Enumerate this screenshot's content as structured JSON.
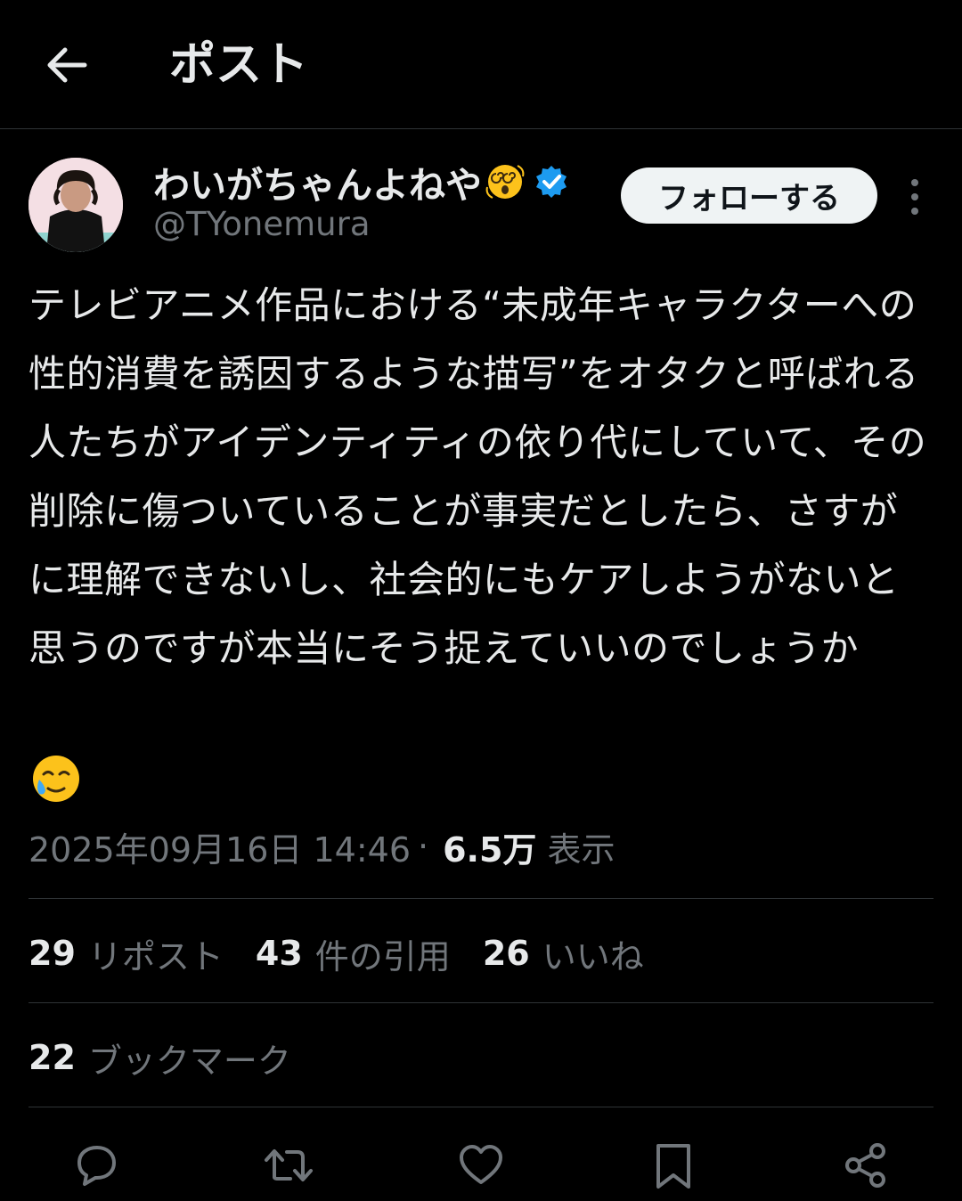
{
  "header": {
    "title": "ポスト",
    "back_icon": "arrow-left-icon"
  },
  "author": {
    "display_name": "わいがちゃんよねや",
    "name_emoji": "face-with-spiral-eyes",
    "verified": true,
    "handle": "@TYonemura",
    "follow_label": "フォローする"
  },
  "post": {
    "text": "テレビアニメ作品における“未成年キャラクターへの性的消費を誘因するような描写”をオタクと呼ばれる人たちがアイデンティティの依り代にしていて、その削除に傷ついていることが事実だとしたら、さすがに理解できないし、社会的にもケアしようがないと思うのですが本当にそう捉えていいのでしょうか",
    "trailing_emoji": "face-holding-back-tears",
    "timestamp": "2025年09月16日 14:46",
    "separator": "·",
    "views_count": "6.5万",
    "views_label": "表示"
  },
  "stats": {
    "reposts_count": "29",
    "reposts_label": "リポスト",
    "quotes_count": "43",
    "quotes_label": "件の引用",
    "likes_count": "26",
    "likes_label": "いいね",
    "bookmarks_count": "22",
    "bookmarks_label": "ブックマーク"
  },
  "actions": [
    "reply-icon",
    "repost-icon",
    "like-icon",
    "bookmark-icon",
    "share-icon"
  ],
  "colors": {
    "background": "#000000",
    "text_primary": "#e7e9ea",
    "text_secondary": "#71767b",
    "divider": "#2f3336",
    "verified_blue": "#1d9bf0",
    "follow_bg": "#eff3f4"
  }
}
